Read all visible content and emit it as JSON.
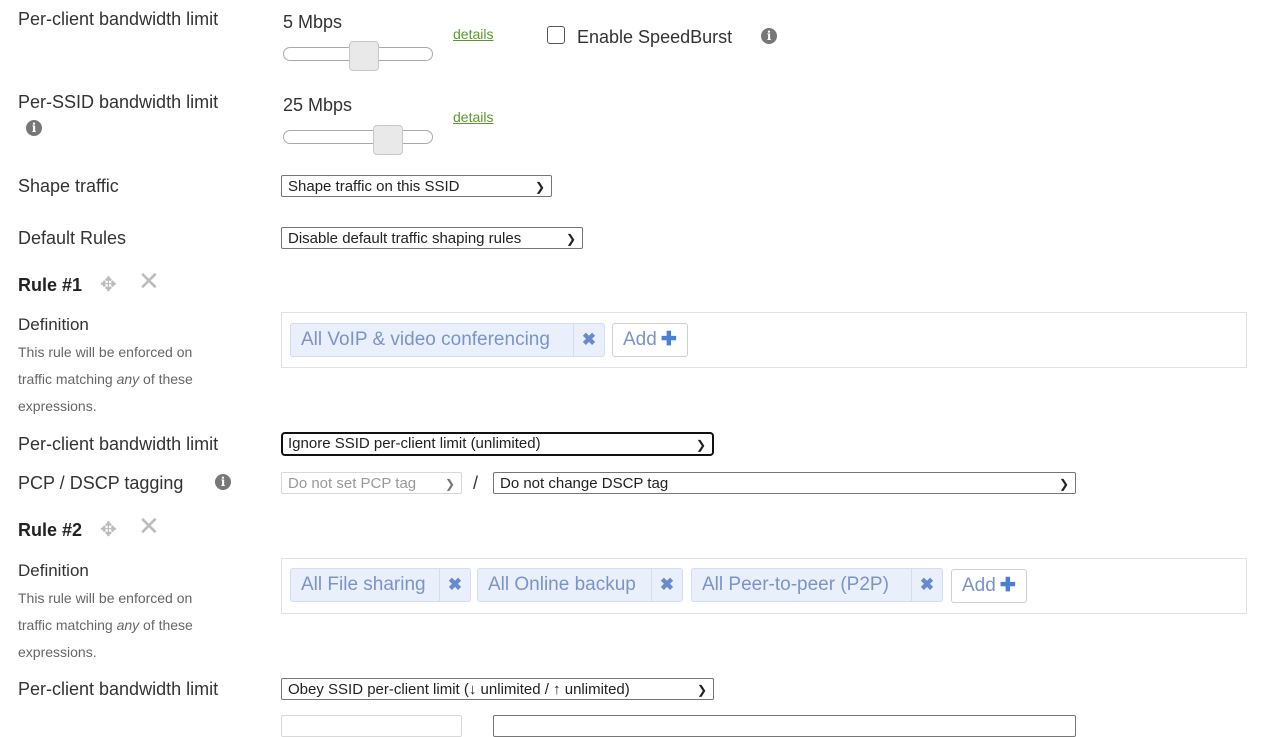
{
  "per_client_limit": {
    "label": "Per-client bandwidth limit",
    "value": "5 Mbps",
    "slider_fraction": 0.55,
    "details_link": "details",
    "speedburst": {
      "label": "Enable SpeedBurst",
      "checked": false,
      "info_icon": "info-icon"
    }
  },
  "per_ssid_limit": {
    "label": "Per-SSID bandwidth limit",
    "value": "25 Mbps",
    "slider_fraction": 0.75,
    "details_link": "details",
    "info_icon": "info-icon"
  },
  "shape_traffic": {
    "label": "Shape traffic",
    "selected": "Shape traffic on this SSID"
  },
  "default_rules": {
    "label": "Default Rules",
    "selected": "Disable default traffic shaping rules"
  },
  "rules": [
    {
      "title": "Rule #1",
      "move_icon": "move-icon",
      "remove_icon": "close-icon",
      "definition": {
        "label": "Definition",
        "help_line1": "This rule will be enforced on",
        "help_line2_pre": "traffic matching ",
        "help_line2_em": "any",
        "help_line2_post": " of these",
        "help_line3": "expressions.",
        "tags": [
          "All VoIP & video conferencing"
        ],
        "add_label": "Add"
      },
      "per_client": {
        "label": "Per-client bandwidth limit",
        "selected": "Ignore SSID per-client limit (unlimited)"
      },
      "tagging": {
        "label": "PCP / DSCP tagging",
        "pcp_selected": "Do not set PCP tag",
        "separator": "/",
        "dscp_selected": "Do not change DSCP tag"
      }
    },
    {
      "title": "Rule #2",
      "move_icon": "move-icon",
      "remove_icon": "close-icon",
      "definition": {
        "label": "Definition",
        "help_line1": "This rule will be enforced on",
        "help_line2_pre": "traffic matching ",
        "help_line2_em": "any",
        "help_line2_post": " of these",
        "help_line3": "expressions.",
        "tags": [
          "All File sharing",
          "All Online backup",
          "All Peer-to-peer (P2P)"
        ],
        "add_label": "Add"
      },
      "per_client": {
        "label": "Per-client bandwidth limit",
        "selected": "Obey SSID per-client limit (↓ unlimited / ↑ unlimited)"
      }
    }
  ],
  "colors": {
    "link": "#5a9a2c",
    "tag_bg": "#e9f0fb",
    "tag_text": "#7b93c9",
    "plus": "#4a7fd6"
  }
}
